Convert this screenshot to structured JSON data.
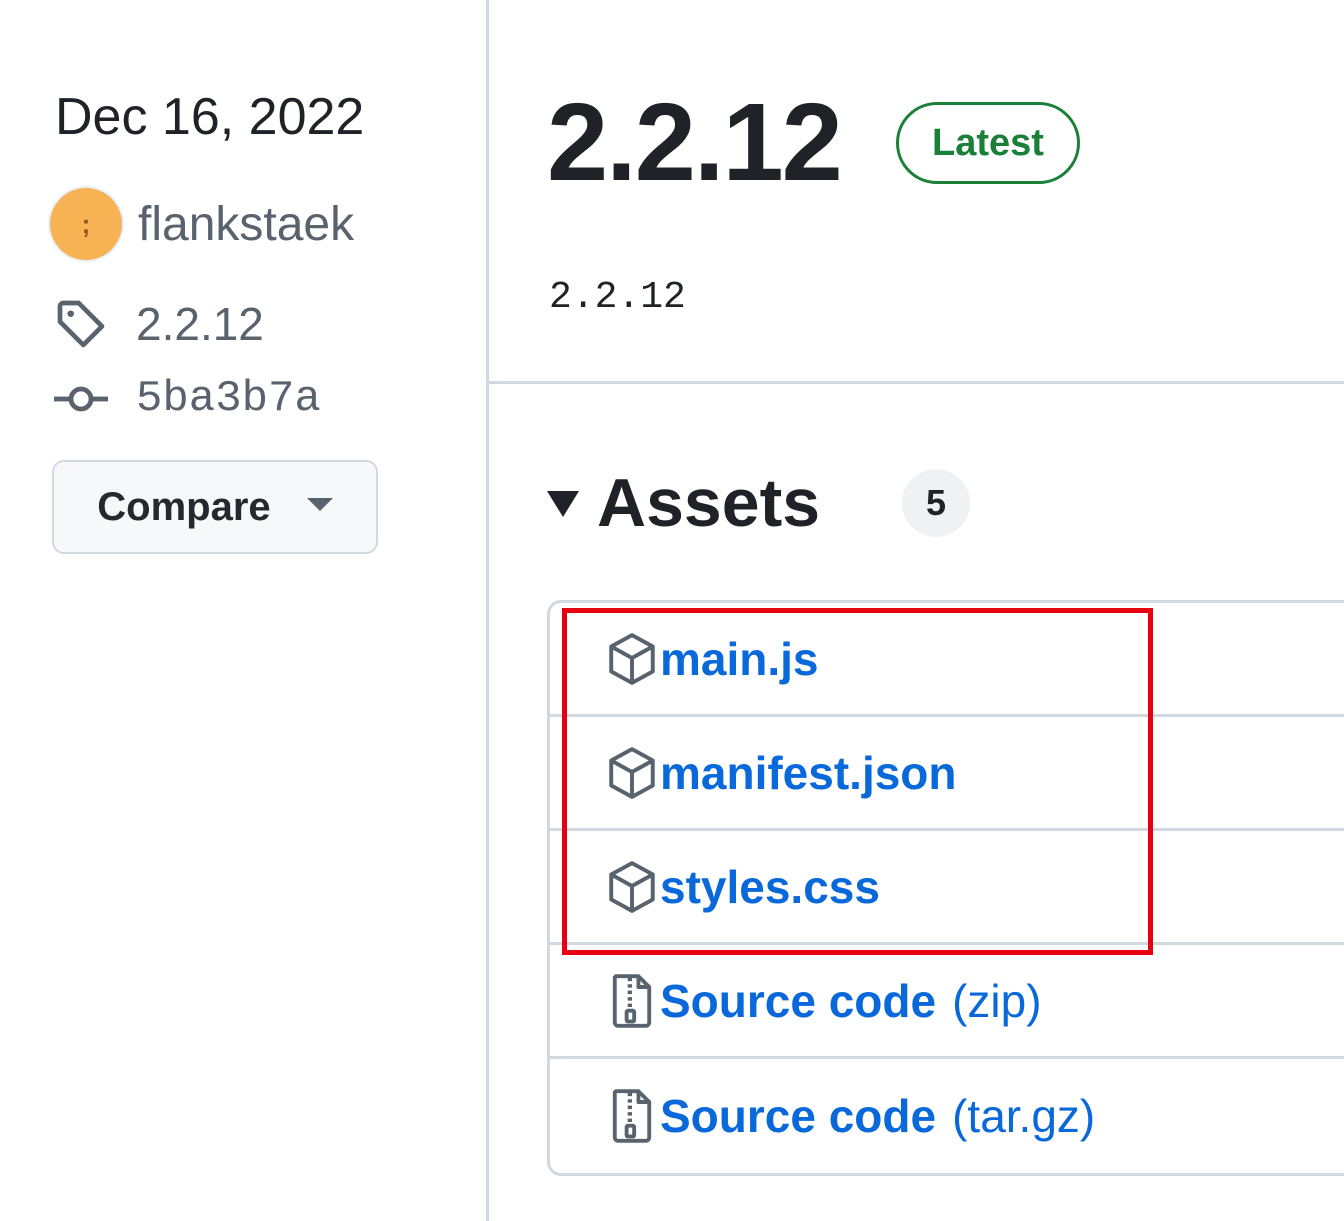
{
  "sidebar": {
    "date": "Dec 16, 2022",
    "author": {
      "name": "flankstaek",
      "avatar_glyph": ";"
    },
    "tag": "2.2.12",
    "commit": "5ba3b7a",
    "compare_label": "Compare"
  },
  "release": {
    "title": "2.2.12",
    "badge": "Latest",
    "tag_text": "2.2.12"
  },
  "assets": {
    "title": "Assets",
    "count": "5",
    "items": [
      {
        "name": "main.js",
        "suffix": "",
        "icon": "package-icon"
      },
      {
        "name": "manifest.json",
        "suffix": "",
        "icon": "package-icon"
      },
      {
        "name": "styles.css",
        "suffix": "",
        "icon": "package-icon"
      },
      {
        "name": "Source code",
        "suffix": "(zip)",
        "icon": "file-zip-icon"
      },
      {
        "name": "Source code",
        "suffix": "(tar.gz)",
        "icon": "file-zip-icon"
      }
    ]
  },
  "colors": {
    "link": "#0969da",
    "badge_green": "#1a7f37",
    "highlight": "#e60012",
    "avatar": "#f6b253",
    "border": "#d1d9e0"
  }
}
